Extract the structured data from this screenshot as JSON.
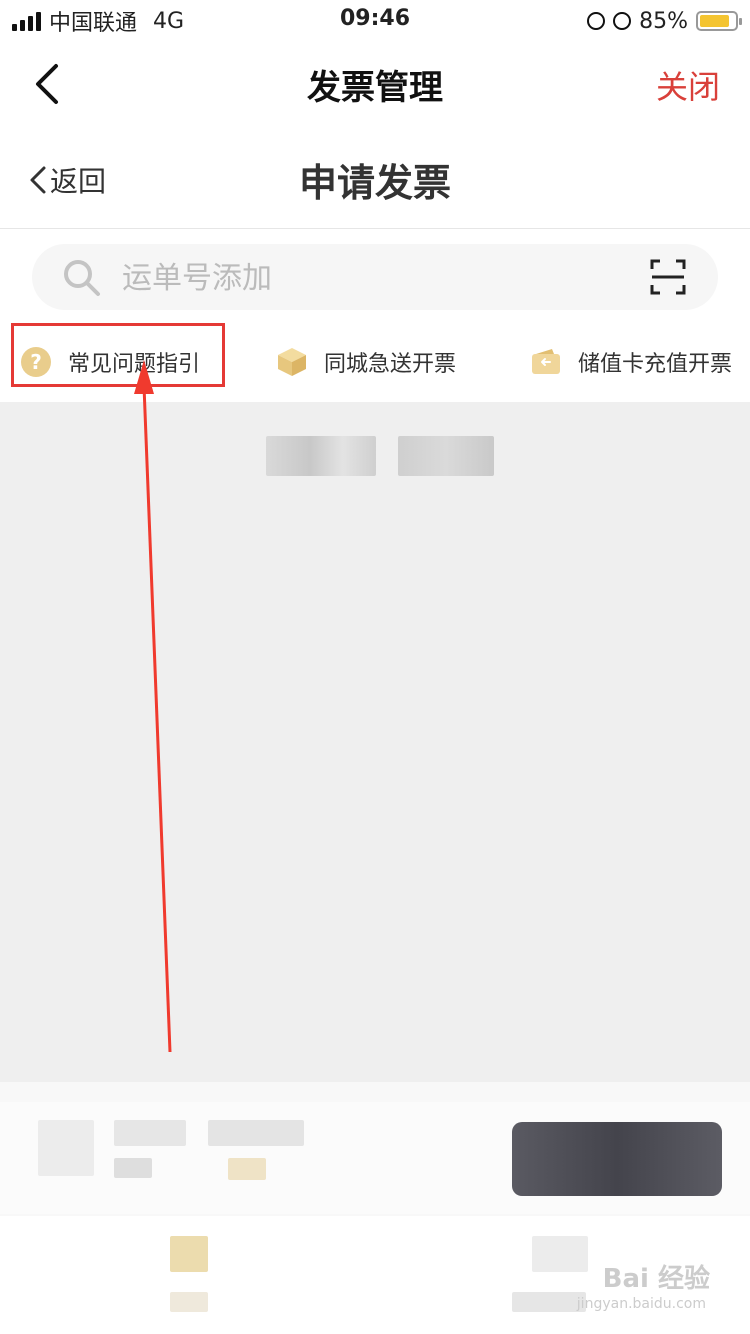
{
  "status_bar": {
    "carrier": "中国联通",
    "network": "4G",
    "time": "09:46",
    "battery": "85%",
    "battery_level": 0.85,
    "battery_color": "#f4c430"
  },
  "nav": {
    "title": "发票管理",
    "close_label": "关闭",
    "close_color": "#d9403a",
    "back_icon": "chevron-left-icon"
  },
  "sub_header": {
    "back_label": "返回",
    "title": "申请发票"
  },
  "search": {
    "placeholder": "运单号添加",
    "icon": "search-icon",
    "scan_icon": "scan-icon"
  },
  "quick_links": [
    {
      "label": "常见问题指引",
      "icon": "question-circle-icon"
    },
    {
      "label": "同城急送开票",
      "icon": "box-icon"
    },
    {
      "label": "储值卡充值开票",
      "icon": "wallet-icon"
    }
  ],
  "annotation": {
    "highlight_color": "#e53935"
  },
  "watermark": {
    "brand": "Bai 经验",
    "url": "jingyan.baidu.com"
  }
}
